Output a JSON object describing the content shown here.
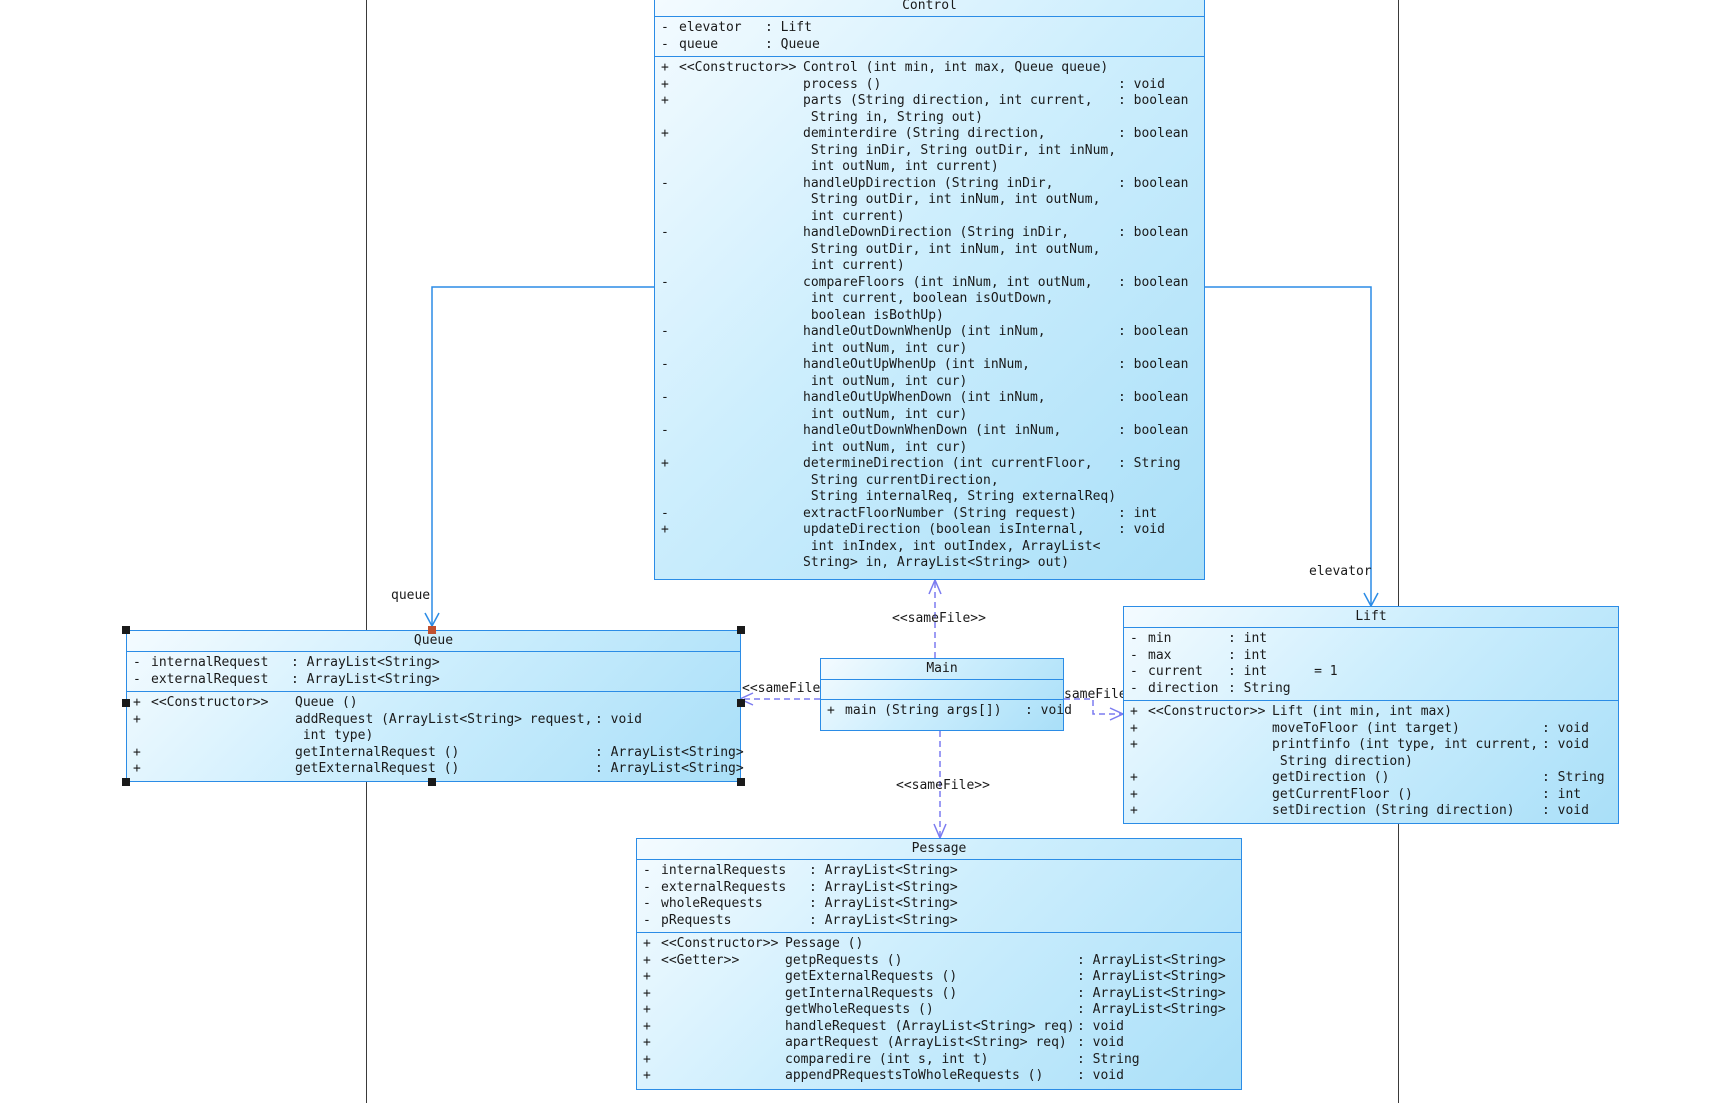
{
  "classes": {
    "control": {
      "name": "Control",
      "attributes": [
        {
          "vis": "-",
          "name": "elevator",
          "type": ": Lift"
        },
        {
          "vis": "-",
          "name": "queue",
          "type": ": Queue"
        }
      ],
      "operations": [
        {
          "vis": "+",
          "stereo": "<<Constructor>>",
          "sig": "Control (int min, int max, Queue queue)",
          "ret": ""
        },
        {
          "vis": "+",
          "stereo": "",
          "sig": "process ()",
          "ret": ": void"
        },
        {
          "vis": "+",
          "stereo": "",
          "sig": "parts (String direction, int current,\n String in, String out)",
          "ret": ": boolean"
        },
        {
          "vis": "+",
          "stereo": "",
          "sig": "deminterdire (String direction,\n String inDir, String outDir, int inNum,\n int outNum, int current)",
          "ret": ": boolean"
        },
        {
          "vis": "-",
          "stereo": "",
          "sig": "handleUpDirection (String inDir,\n String outDir, int inNum, int outNum,\n int current)",
          "ret": ": boolean"
        },
        {
          "vis": "-",
          "stereo": "",
          "sig": "handleDownDirection (String inDir,\n String outDir, int inNum, int outNum,\n int current)",
          "ret": ": boolean"
        },
        {
          "vis": "-",
          "stereo": "",
          "sig": "compareFloors (int inNum, int outNum,\n int current, boolean isOutDown,\n boolean isBothUp)",
          "ret": ": boolean"
        },
        {
          "vis": "-",
          "stereo": "",
          "sig": "handleOutDownWhenUp (int inNum,\n int outNum, int cur)",
          "ret": ": boolean"
        },
        {
          "vis": "-",
          "stereo": "",
          "sig": "handleOutUpWhenUp (int inNum,\n int outNum, int cur)",
          "ret": ": boolean"
        },
        {
          "vis": "-",
          "stereo": "",
          "sig": "handleOutUpWhenDown (int inNum,\n int outNum, int cur)",
          "ret": ": boolean"
        },
        {
          "vis": "-",
          "stereo": "",
          "sig": "handleOutDownWhenDown (int inNum,\n int outNum, int cur)",
          "ret": ": boolean"
        },
        {
          "vis": "+",
          "stereo": "",
          "sig": "determineDirection (int currentFloor,\n String currentDirection,\n String internalReq, String externalReq)",
          "ret": ": String"
        },
        {
          "vis": "-",
          "stereo": "",
          "sig": "extractFloorNumber (String request)",
          "ret": ": int"
        },
        {
          "vis": "+",
          "stereo": "",
          "sig": "updateDirection (boolean isInternal,\n int inIndex, int outIndex, ArrayList<\nString> in, ArrayList<String> out)",
          "ret": ": void"
        }
      ]
    },
    "queue": {
      "name": "Queue",
      "attributes": [
        {
          "vis": "-",
          "name": "internalRequest",
          "type": ": ArrayList<String>"
        },
        {
          "vis": "-",
          "name": "externalRequest",
          "type": ": ArrayList<String>"
        }
      ],
      "operations": [
        {
          "vis": "+",
          "stereo": "<<Constructor>>",
          "sig": "Queue ()",
          "ret": ""
        },
        {
          "vis": "+",
          "stereo": "",
          "sig": "addRequest (ArrayList<String> request,\n int type)",
          "ret": ": void"
        },
        {
          "vis": "+",
          "stereo": "",
          "sig": "getInternalRequest ()",
          "ret": ": ArrayList<String>"
        },
        {
          "vis": "+",
          "stereo": "",
          "sig": "getExternalRequest ()",
          "ret": ": ArrayList<String>"
        }
      ]
    },
    "main": {
      "name": "Main",
      "attributes": [],
      "operations": [
        {
          "vis": "+",
          "stereo": "",
          "sig": "main (String args[])",
          "ret": ": void"
        }
      ]
    },
    "lift": {
      "name": "Lift",
      "attributes": [
        {
          "vis": "-",
          "name": "min",
          "type": ": int"
        },
        {
          "vis": "-",
          "name": "max",
          "type": ": int"
        },
        {
          "vis": "-",
          "name": "current",
          "type": ": int      = 1"
        },
        {
          "vis": "-",
          "name": "direction",
          "type": ": String"
        }
      ],
      "operations": [
        {
          "vis": "+",
          "stereo": "<<Constructor>>",
          "sig": "Lift (int min, int max)",
          "ret": ""
        },
        {
          "vis": "+",
          "stereo": "",
          "sig": "moveToFloor (int target)",
          "ret": ": void"
        },
        {
          "vis": "+",
          "stereo": "",
          "sig": "printfinfo (int type, int current,\n String direction)",
          "ret": ": void"
        },
        {
          "vis": "+",
          "stereo": "",
          "sig": "getDirection ()",
          "ret": ": String"
        },
        {
          "vis": "+",
          "stereo": "",
          "sig": "getCurrentFloor ()",
          "ret": ": int"
        },
        {
          "vis": "+",
          "stereo": "",
          "sig": "setDirection (String direction)",
          "ret": ": void"
        }
      ]
    },
    "pessage": {
      "name": "Pessage",
      "attributes": [
        {
          "vis": "-",
          "name": "internalRequests",
          "type": ": ArrayList<String>"
        },
        {
          "vis": "-",
          "name": "externalRequests",
          "type": ": ArrayList<String>"
        },
        {
          "vis": "-",
          "name": "wholeRequests",
          "type": ": ArrayList<String>"
        },
        {
          "vis": "-",
          "name": "pRequests",
          "type": ": ArrayList<String>"
        }
      ],
      "operations": [
        {
          "vis": "+",
          "stereo": "<<Constructor>>",
          "sig": "Pessage ()",
          "ret": ""
        },
        {
          "vis": "+",
          "stereo": "<<Getter>>",
          "sig": "getpRequests ()",
          "ret": ": ArrayList<String>"
        },
        {
          "vis": "+",
          "stereo": "",
          "sig": "getExternalRequests ()",
          "ret": ": ArrayList<String>"
        },
        {
          "vis": "+",
          "stereo": "",
          "sig": "getInternalRequests ()",
          "ret": ": ArrayList<String>"
        },
        {
          "vis": "+",
          "stereo": "",
          "sig": "getWholeRequests ()",
          "ret": ": ArrayList<String>"
        },
        {
          "vis": "+",
          "stereo": "",
          "sig": "handleRequest (ArrayList<String> req)",
          "ret": ": void"
        },
        {
          "vis": "+",
          "stereo": "",
          "sig": "apartRequest (ArrayList<String> req)",
          "ret": ": void"
        },
        {
          "vis": "+",
          "stereo": "",
          "sig": "comparedire (int s, int t)",
          "ret": ": String"
        },
        {
          "vis": "+",
          "stereo": "",
          "sig": "appendPRequestsToWholeRequests ()",
          "ret": ": void"
        }
      ]
    }
  },
  "labels": {
    "queue_role": "queue",
    "elevator_role": "elevator",
    "samefile_up": "<<sameFile>>",
    "samefile_left": "<<sameFile>>",
    "samefile_right": "sameFile",
    "samefile_down": "<<sameFile>>"
  },
  "colors": {
    "border": "#2b8ce6",
    "fill_light": "#f4fbff",
    "fill_dark": "#a9dff8",
    "dependency": "#7b7bf0"
  }
}
